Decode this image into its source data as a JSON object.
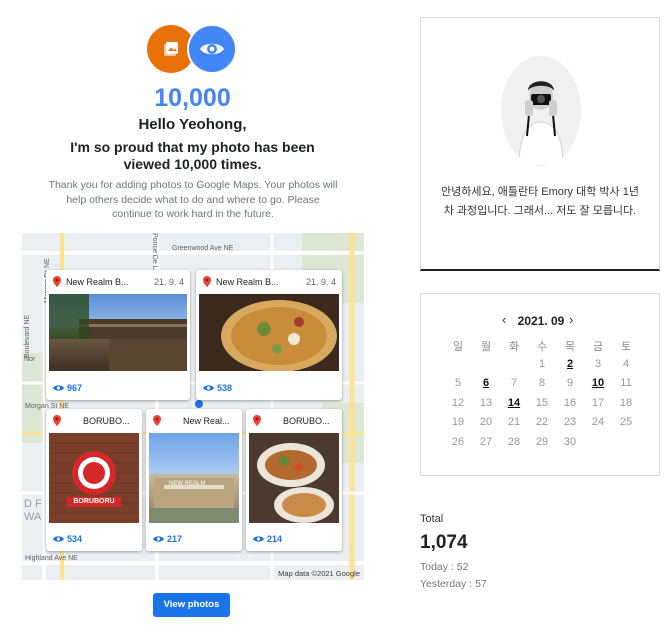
{
  "email": {
    "milestone": "10,000",
    "greeting": "Hello Yeohong,",
    "headline": "I'm so proud that my photo has been viewed 10,000 times.",
    "body": "Thank you for adding photos to Google Maps. Your photos will help others decide what to do and where to go. Please continue to work hard in the future.",
    "map_credit": "Map data ©2021 Google",
    "streets": [
      "Greenwood Ave NE",
      "Ponce De Le",
      "Monroe Dr NE",
      "Boulevard NE",
      "Morgan St NE",
      "Highland Ave NE",
      "Nor",
      "D F",
      "WA"
    ],
    "cards": [
      {
        "place": "New Realm B...",
        "date": "21. 9. 4",
        "views": "967"
      },
      {
        "place": "New Realm B...",
        "date": "21. 9. 4",
        "views": "538"
      },
      {
        "place": "BORUBO...",
        "views": "534",
        "sign_text": "BORUBORU"
      },
      {
        "place": "New Real...",
        "views": "217",
        "sign_text": "NEW REALM"
      },
      {
        "place": "BORUBO...",
        "views": "214"
      }
    ],
    "button_label": "View photos"
  },
  "profile": {
    "bio": "안녕하세요, 애틀란타 Emory 대학 박사 1년차 과정입니다. 그래서... 저도 잘 모릅니다."
  },
  "calendar": {
    "prev": "‹",
    "next": "›",
    "title": "2021. 09",
    "weekdays": [
      "일",
      "월",
      "화",
      "수",
      "목",
      "금",
      "토"
    ],
    "weeks": [
      [
        "",
        "",
        "",
        "1",
        "2",
        "3",
        "4"
      ],
      [
        "5",
        "6",
        "7",
        "8",
        "9",
        "10",
        "11"
      ],
      [
        "12",
        "13",
        "14",
        "15",
        "16",
        "17",
        "18"
      ],
      [
        "19",
        "20",
        "21",
        "22",
        "23",
        "24",
        "25"
      ],
      [
        "26",
        "27",
        "28",
        "29",
        "30",
        "",
        ""
      ]
    ],
    "linked_days": [
      "2",
      "6",
      "10",
      "14"
    ]
  },
  "stats": {
    "total_label": "Total",
    "total": "1,074",
    "today": "Today : 52",
    "yesterday": "Yesterday : 57"
  },
  "colors": {
    "accent_blue": "#4285f4",
    "orange": "#e8710a",
    "button_blue": "#1a73e8",
    "pin_red": "#ea4335"
  }
}
